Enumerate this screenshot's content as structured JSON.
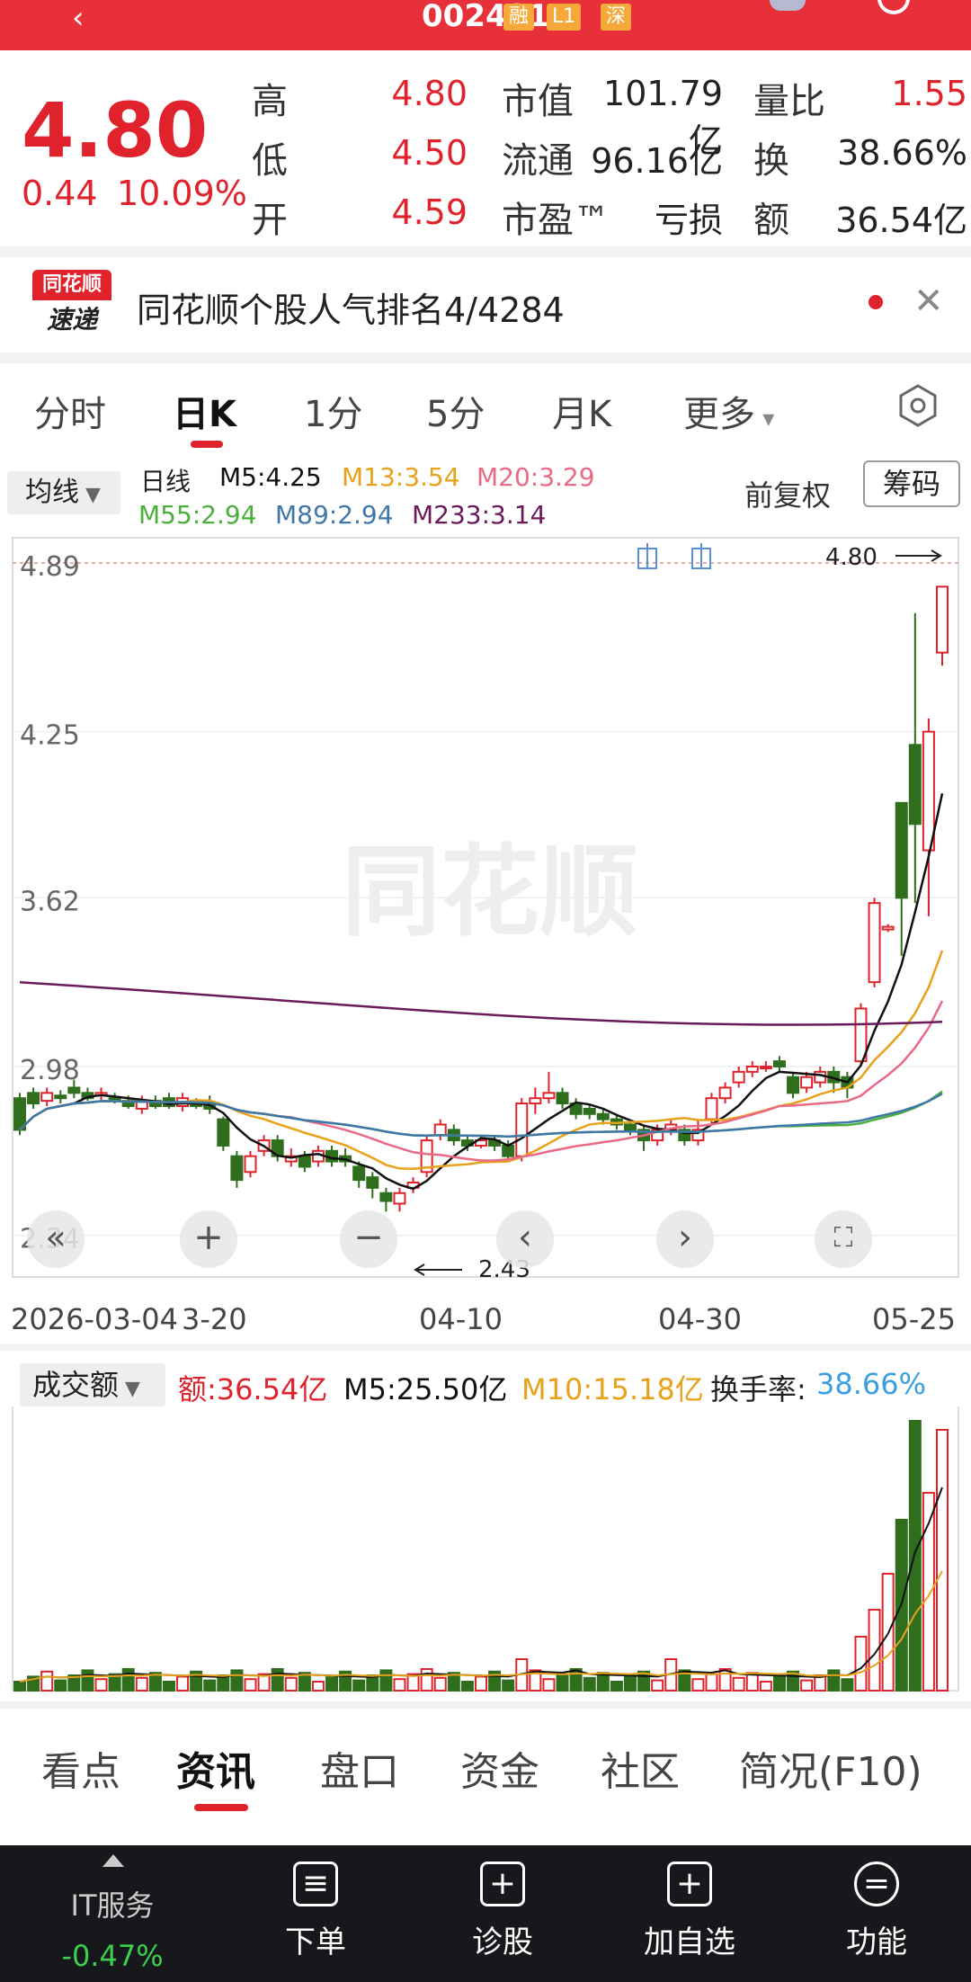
{
  "header": {
    "code": "002421",
    "badges": [
      "融",
      "L1",
      "深"
    ]
  },
  "quote": {
    "price": "4.80",
    "change": "0.44",
    "change_pct": "10.09%",
    "fields": [
      {
        "label": "高",
        "value": "4.80"
      },
      {
        "label": "低",
        "value": "4.50"
      },
      {
        "label": "开",
        "value": "4.59"
      },
      {
        "label": "市值",
        "value": "101.79亿"
      },
      {
        "label": "流通",
        "value": "96.16亿"
      },
      {
        "label": "市盈™",
        "value": "亏损"
      },
      {
        "label": "量比",
        "value": "1.55"
      },
      {
        "label": "换",
        "value": "38.66%"
      },
      {
        "label": "额",
        "value": "36.54亿"
      }
    ]
  },
  "news": {
    "logo_top": "同花顺",
    "logo_bottom": "速递",
    "text": "同花顺个股人气排名4/4284"
  },
  "period_tabs": [
    "分时",
    "日K",
    "1分",
    "5分",
    "月K",
    "更多"
  ],
  "ma": {
    "button": "均线",
    "period": "日线",
    "lines": [
      {
        "label": "M5:4.25",
        "color": "#111111"
      },
      {
        "label": "M13:3.54",
        "color": "#e8a21a"
      },
      {
        "label": "M20:3.29",
        "color": "#e86a86"
      },
      {
        "label": "M55:2.94",
        "color": "#4cae3c"
      },
      {
        "label": "M89:2.94",
        "color": "#3f77a8"
      },
      {
        "label": "M233:3.14",
        "color": "#6a1a5a"
      }
    ],
    "adjust": "前复权",
    "chips": "筹码"
  },
  "chart_data": {
    "type": "candlestick",
    "y_ticks": [
      "4.89",
      "4.25",
      "3.62",
      "2.98",
      "2.34"
    ],
    "high_marker": "4.80",
    "low_marker": "2.43",
    "x_ticks": [
      "2026-03-04",
      "3-20",
      "04-10",
      "04-30",
      "05-25"
    ],
    "volume": {
      "button": "成交额",
      "amount_label": "额:36.54亿",
      "m5_label": "M5:25.50亿",
      "m10_label": "M10:15.18亿",
      "turnover_label": "换手率:",
      "turnover_value": "38.66%"
    }
  },
  "bottom_tabs": [
    "看点",
    "资讯",
    "盘口",
    "资金",
    "社区",
    "简况(F10)"
  ],
  "bottom_bar": {
    "it_label": "IT服务",
    "it_change": "-0.47%",
    "items": [
      {
        "label": "下单",
        "icon": "order-icon"
      },
      {
        "label": "诊股",
        "icon": "diagnose-icon"
      },
      {
        "label": "加自选",
        "icon": "add-favorite-icon"
      },
      {
        "label": "功能",
        "icon": "menu-icon"
      }
    ]
  },
  "colors": {
    "up": "#e0222c",
    "down": "#2e6e1c",
    "brand": "#e8303a"
  }
}
